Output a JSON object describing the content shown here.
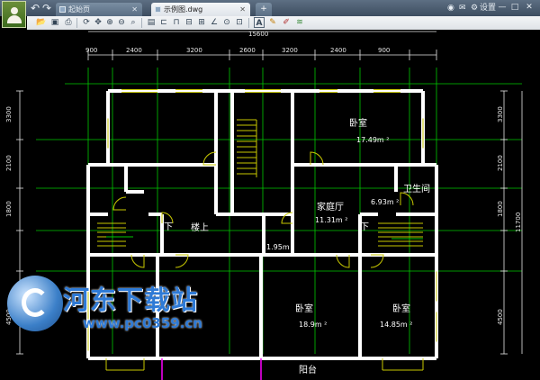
{
  "titlebar": {
    "tabs": [
      {
        "label": "起始页"
      },
      {
        "label": "示例图.dwg"
      }
    ],
    "new_tab": "+",
    "settings_label": "设置",
    "minimize": "—",
    "maximize": "□",
    "close": "✕"
  },
  "toolbar": {
    "icons": [
      "open-icon",
      "save-icon",
      "print-icon",
      "refresh-icon",
      "pan-icon",
      "zoom-in-icon",
      "zoom-out-icon",
      "zoom-extents-icon",
      "layer-icon",
      "dimension-icon",
      "distance-icon",
      "area-icon",
      "coordinate-icon",
      "angle-icon",
      "text-icon",
      "pencil-icon",
      "markup-icon",
      "layers-icon"
    ],
    "text_tool": "A"
  },
  "drawing": {
    "colors": {
      "wall": "#ffffff",
      "dimension": "#e6e6e6",
      "gridline": "#00c800",
      "window": "#c8c800",
      "stair": "#c8c800",
      "door": "#c8c800",
      "balcony_rail": "#ff00ff"
    },
    "top_total": "15600",
    "top_dims": [
      "900",
      "2400",
      "3200",
      "2600",
      "3200",
      "2400",
      "900"
    ],
    "left_dims": [
      "3300",
      "2100",
      "1800",
      "4500"
    ],
    "right_dims": [
      "3300",
      "2100",
      "1800",
      "4500"
    ],
    "right_total": "11700",
    "rooms": [
      {
        "name": "卧室",
        "area": "17.49m ²"
      },
      {
        "name": "家庭厅",
        "area": "11.31m ²"
      },
      {
        "name": "卫生间",
        "area": "6.93m ²"
      },
      {
        "name": "楼上",
        "area": ""
      },
      {
        "name": "下",
        "area": ""
      },
      {
        "name": "下",
        "area": ""
      },
      {
        "name": "",
        "area": "1.95m ²"
      },
      {
        "name": "卧室",
        "area": "18.9m ²"
      },
      {
        "name": "卧室",
        "area": "14.85m ²"
      },
      {
        "name": "阳台",
        "area": ""
      }
    ]
  },
  "watermark": {
    "title": "河东下载站",
    "url": "www.pc0359.cn"
  }
}
